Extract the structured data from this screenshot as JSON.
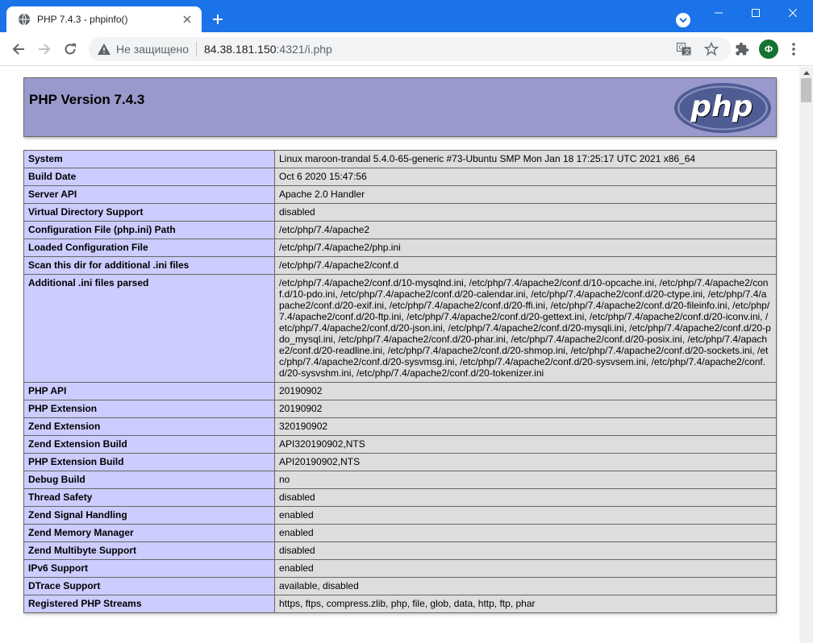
{
  "browser": {
    "tab_title": "PHP 7.4.3 - phpinfo()",
    "security_label": "Не защищено",
    "url_host": "84.38.181.150",
    "url_path": ":4321/i.php",
    "profile_initial": "Ф",
    "accent": "#1a73e8"
  },
  "page": {
    "version_title": "PHP Version 7.4.3",
    "logo_text": "php",
    "rows": [
      {
        "k": "System",
        "v": "Linux maroon-trandal 5.4.0-65-generic #73-Ubuntu SMP Mon Jan 18 17:25:17 UTC 2021 x86_64"
      },
      {
        "k": "Build Date",
        "v": "Oct 6 2020 15:47:56"
      },
      {
        "k": "Server API",
        "v": "Apache 2.0 Handler"
      },
      {
        "k": "Virtual Directory Support",
        "v": "disabled"
      },
      {
        "k": "Configuration File (php.ini) Path",
        "v": "/etc/php/7.4/apache2"
      },
      {
        "k": "Loaded Configuration File",
        "v": "/etc/php/7.4/apache2/php.ini"
      },
      {
        "k": "Scan this dir for additional .ini files",
        "v": "/etc/php/7.4/apache2/conf.d"
      },
      {
        "k": "Additional .ini files parsed",
        "v": "/etc/php/7.4/apache2/conf.d/10-mysqlnd.ini, /etc/php/7.4/apache2/conf.d/10-opcache.ini, /etc/php/7.4/apache2/conf.d/10-pdo.ini, /etc/php/7.4/apache2/conf.d/20-calendar.ini, /etc/php/7.4/apache2/conf.d/20-ctype.ini, /etc/php/7.4/apache2/conf.d/20-exif.ini, /etc/php/7.4/apache2/conf.d/20-ffi.ini, /etc/php/7.4/apache2/conf.d/20-fileinfo.ini, /etc/php/7.4/apache2/conf.d/20-ftp.ini, /etc/php/7.4/apache2/conf.d/20-gettext.ini, /etc/php/7.4/apache2/conf.d/20-iconv.ini, /etc/php/7.4/apache2/conf.d/20-json.ini, /etc/php/7.4/apache2/conf.d/20-mysqli.ini, /etc/php/7.4/apache2/conf.d/20-pdo_mysql.ini, /etc/php/7.4/apache2/conf.d/20-phar.ini, /etc/php/7.4/apache2/conf.d/20-posix.ini, /etc/php/7.4/apache2/conf.d/20-readline.ini, /etc/php/7.4/apache2/conf.d/20-shmop.ini, /etc/php/7.4/apache2/conf.d/20-sockets.ini, /etc/php/7.4/apache2/conf.d/20-sysvmsg.ini, /etc/php/7.4/apache2/conf.d/20-sysvsem.ini, /etc/php/7.4/apache2/conf.d/20-sysvshm.ini, /etc/php/7.4/apache2/conf.d/20-tokenizer.ini"
      },
      {
        "k": "PHP API",
        "v": "20190902"
      },
      {
        "k": "PHP Extension",
        "v": "20190902"
      },
      {
        "k": "Zend Extension",
        "v": "320190902"
      },
      {
        "k": "Zend Extension Build",
        "v": "API320190902,NTS"
      },
      {
        "k": "PHP Extension Build",
        "v": "API20190902,NTS"
      },
      {
        "k": "Debug Build",
        "v": "no"
      },
      {
        "k": "Thread Safety",
        "v": "disabled"
      },
      {
        "k": "Zend Signal Handling",
        "v": "enabled"
      },
      {
        "k": "Zend Memory Manager",
        "v": "enabled"
      },
      {
        "k": "Zend Multibyte Support",
        "v": "disabled"
      },
      {
        "k": "IPv6 Support",
        "v": "enabled"
      },
      {
        "k": "DTrace Support",
        "v": "available, disabled"
      },
      {
        "k": "Registered PHP Streams",
        "v": "https, ftps, compress.zlib, php, file, glob, data, http, ftp, phar"
      }
    ]
  }
}
